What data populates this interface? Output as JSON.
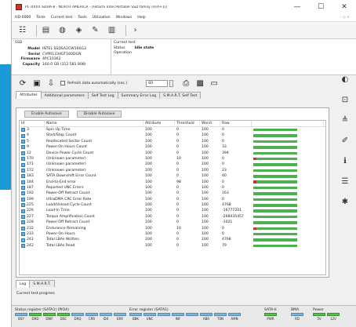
{
  "window": {
    "title": "PC-XXXX SDHA-8 - NORTH AMERICA - [Hitachi Intel Portable SSD family (ATA+1)]",
    "controls": {
      "minimize": "—",
      "maximize": "☐",
      "close": "✕"
    }
  },
  "menu": {
    "items": [
      "HD-0000",
      "Tests",
      "Current test",
      "Tools",
      "Utilization",
      "Windows",
      "Help"
    ],
    "right": "– ◇ ×"
  },
  "device": {
    "label": "SSD",
    "model": "INTEL SSDSA2CW160G3",
    "serial": "CVPR1234GT160DGN",
    "firmware": "4PC10362",
    "capacity": "160.0 GB (312 581 808)"
  },
  "info_labels": {
    "model": "Model",
    "serial": "Serial",
    "firmware": "Firmware",
    "capacity": "Capacity"
  },
  "current_test": {
    "header": "Current test",
    "status_label": "Status",
    "status_value": "Idle state",
    "operation_label": "Operation",
    "operation_value": ""
  },
  "controls": {
    "refresh_label": "Refresh data automatically (sec.)",
    "interval": "60"
  },
  "tabs": [
    "Attributes",
    "Additional parameters",
    "Self Test Log",
    "Summary Error Log",
    "S.M.A.R.T. Self Test"
  ],
  "buttons": {
    "enable": "Enable Autosave",
    "disable": "Disable Autosave"
  },
  "columns": [
    "Id",
    "Name",
    "Attribute",
    "Threshold",
    "Worst",
    "Raw"
  ],
  "attributes": [
    {
      "id": "3",
      "name": "Spin Up Time",
      "attr": "100",
      "thr": "0",
      "worst": "100",
      "raw": "0",
      "red": false
    },
    {
      "id": "4",
      "name": "Start/Stop Count",
      "attr": "100",
      "thr": "0",
      "worst": "100",
      "raw": "0",
      "red": false
    },
    {
      "id": "5",
      "name": "Reallocated Sector Count",
      "attr": "100",
      "thr": "0",
      "worst": "100",
      "raw": "0",
      "red": false
    },
    {
      "id": "9",
      "name": "Power-On Hours Count",
      "attr": "100",
      "thr": "0",
      "worst": "100",
      "raw": "33",
      "red": false
    },
    {
      "id": "12",
      "name": "Device Power Cycle Count",
      "attr": "100",
      "thr": "0",
      "worst": "100",
      "raw": "394",
      "red": false
    },
    {
      "id": "170",
      "name": "(Unknown parameter)",
      "attr": "100",
      "thr": "10",
      "worst": "100",
      "raw": "0",
      "red": true
    },
    {
      "id": "171",
      "name": "(Unknown parameter)",
      "attr": "100",
      "thr": "0",
      "worst": "100",
      "raw": "0",
      "red": false
    },
    {
      "id": "172",
      "name": "(Unknown parameter)",
      "attr": "100",
      "thr": "0",
      "worst": "100",
      "raw": "23",
      "red": false
    },
    {
      "id": "183",
      "name": "SATA Downshift Error Count",
      "attr": "100",
      "thr": "0",
      "worst": "100",
      "raw": "40",
      "red": false
    },
    {
      "id": "184",
      "name": "End-to-End error",
      "attr": "100",
      "thr": "98",
      "worst": "100",
      "raw": "0",
      "red": true
    },
    {
      "id": "187",
      "name": "Reported UNC Errors",
      "attr": "100",
      "thr": "0",
      "worst": "100",
      "raw": "0",
      "red": false
    },
    {
      "id": "192",
      "name": "Power-Off Retract Count",
      "attr": "100",
      "thr": "0",
      "worst": "100",
      "raw": "163",
      "red": false
    },
    {
      "id": "199",
      "name": "UltraDMA CRC Error Rate",
      "attr": "100",
      "thr": "0",
      "worst": "100",
      "raw": "0",
      "red": false
    },
    {
      "id": "225",
      "name": "Load/Unload Cycle Count",
      "attr": "100",
      "thr": "0",
      "worst": "100",
      "raw": "4768",
      "red": false
    },
    {
      "id": "226",
      "name": "Load-In Time",
      "attr": "100",
      "thr": "0",
      "worst": "100",
      "raw": "-16777201",
      "red": false
    },
    {
      "id": "227",
      "name": "Torque Amplification Count",
      "attr": "100",
      "thr": "0",
      "worst": "100",
      "raw": "-268435457",
      "red": false
    },
    {
      "id": "228",
      "name": "Power-Off Retract Count",
      "attr": "100",
      "thr": "0",
      "worst": "100",
      "raw": "-1021",
      "red": false
    },
    {
      "id": "232",
      "name": "Endurance Remaining",
      "attr": "100",
      "thr": "10",
      "worst": "100",
      "raw": "0",
      "red": true
    },
    {
      "id": "233",
      "name": "Power-On Hours",
      "attr": "100",
      "thr": "0",
      "worst": "100",
      "raw": "0",
      "red": false
    },
    {
      "id": "241",
      "name": "Total LBAs Written",
      "attr": "100",
      "thr": "0",
      "worst": "100",
      "raw": "4768",
      "red": false
    },
    {
      "id": "242",
      "name": "Total LBAs Read",
      "attr": "100",
      "thr": "0",
      "worst": "100",
      "raw": "79",
      "red": false
    }
  ],
  "log": {
    "tabs": [
      "Log",
      "S.M.A.R.T."
    ],
    "current_progress": "Current test progress"
  },
  "status": {
    "g1": {
      "title": "Status register (SATA1) (PIO4)",
      "lights": [
        "BSY",
        "DRD",
        "DWF",
        "DSC",
        "DRQ",
        "CRR",
        "IDX",
        "ERR"
      ],
      "on": [
        1,
        2,
        3
      ]
    },
    "g2": {
      "title": "Error register (SATA1)",
      "lights": [
        "BBK",
        "UNC",
        "",
        "INF",
        "",
        "ABR",
        "T0N",
        "AMN"
      ],
      "on": []
    },
    "g3": {
      "title": "SATA-II",
      "lights": [
        "PWR"
      ],
      "on": [
        0
      ]
    },
    "g4": {
      "title": "BMA",
      "lights": [
        "RD"
      ],
      "on": []
    },
    "g5": {
      "title": "Power",
      "lights": [
        "5V",
        "12V"
      ],
      "on": [
        0,
        1
      ]
    }
  }
}
